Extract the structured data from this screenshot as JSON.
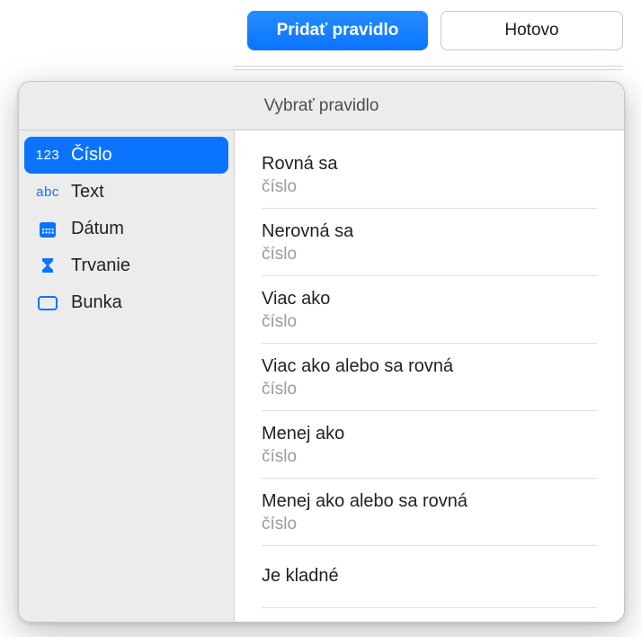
{
  "toolbar": {
    "add_rule": "Pridať pravidlo",
    "done": "Hotovo"
  },
  "popover": {
    "title": "Vybrať pravidlo"
  },
  "sidebar": {
    "items": [
      {
        "id": "number",
        "icon": "123",
        "label": "Číslo"
      },
      {
        "id": "text",
        "icon": "abc",
        "label": "Text"
      },
      {
        "id": "date",
        "icon": "calendar",
        "label": "Dátum"
      },
      {
        "id": "duration",
        "icon": "hourglass",
        "label": "Trvanie"
      },
      {
        "id": "cell",
        "icon": "cell",
        "label": "Bunka"
      }
    ],
    "selected": "number"
  },
  "rules": [
    {
      "title": "Rovná sa",
      "sub": "číslo"
    },
    {
      "title": "Nerovná sa",
      "sub": "číslo"
    },
    {
      "title": "Viac ako",
      "sub": "číslo"
    },
    {
      "title": "Viac ako alebo sa rovná",
      "sub": "číslo"
    },
    {
      "title": "Menej ako",
      "sub": "číslo"
    },
    {
      "title": "Menej ako alebo sa rovná",
      "sub": "číslo"
    },
    {
      "title": "Je kladné",
      "sub": ""
    }
  ]
}
